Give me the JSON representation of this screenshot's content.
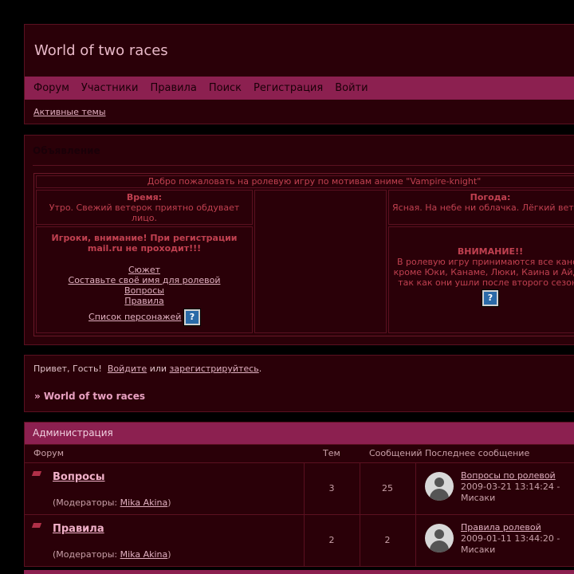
{
  "header": {
    "title": "World of two races",
    "menu": [
      "Форум",
      "Участники",
      "Правила",
      "Поиск",
      "Регистрация",
      "Войти"
    ],
    "active_topics": "Активные темы"
  },
  "announcement": {
    "title": "Объявление",
    "welcome": "Добро пожаловать на ролевую игру по мотивам аниме \"Vampire-knight\"",
    "time_label": "Время:",
    "time_text": "Утро. Свежий ветерок приятно обдувает лицо.",
    "weather_label": "Погода:",
    "weather_text": "Ясная. На небе ни облачка. Лёгкий ветерок ласково шуршит между листвой.",
    "players_warning": "Игроки, внимание! При регистрации mail.ru не проходит!!!",
    "links": [
      "Сюжет",
      "Составьте своё имя для ролевой",
      "Вопросы",
      "Правила",
      "Список персонажей"
    ],
    "attention_label": "ВНИМАНИЕ!!",
    "attention_text": "В ролевую игру принимаются все канон кроме Юки, Канаме, Люки, Каина и Айдо, так как они ушли после второго сезона аниме.",
    "help_icon": "?"
  },
  "guest": {
    "greeting": "Привет, Гость!",
    "login": "Войдите",
    "or": "или",
    "register": "зарегистрируйтесь",
    "dot": ".",
    "forum_link": "» World of two races"
  },
  "forums": {
    "category": "Администрация",
    "columns": {
      "forum": "Форум",
      "topics": "Тем",
      "posts": "Сообщений",
      "last": "Последнее сообщение"
    },
    "moderators_label": "(Модераторы:",
    "moderators_close": ")",
    "rows": [
      {
        "name": "Вопросы",
        "moderator": "Mika Akina",
        "topics": "3",
        "posts": "25",
        "last_title": "Вопросы по ролевой",
        "last_date": "2009-03-21 13:14:24 -",
        "last_author": "Мисаки"
      },
      {
        "name": "Правила",
        "moderator": "Mika Akina",
        "topics": "2",
        "posts": "2",
        "last_title": "Правила ролевой",
        "last_date": "2009-01-11 13:44:20 -",
        "last_author": "Мисаки"
      }
    ]
  },
  "colors": {
    "accent": "#8c2050",
    "panel": "#2a0008",
    "border": "#5a1020"
  }
}
